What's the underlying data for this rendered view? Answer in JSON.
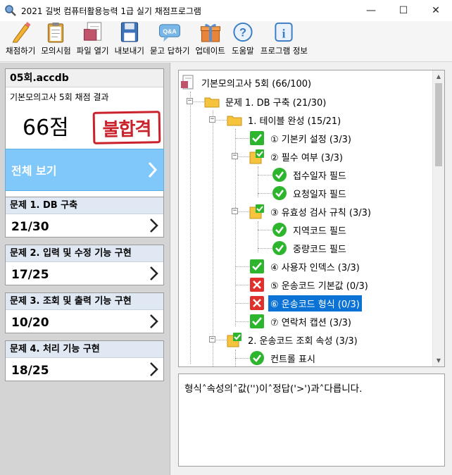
{
  "window": {
    "title": "2021 길벗 컴퓨터활용능력 1급 실기 채점프로그램",
    "controls": [
      "—",
      "☐",
      "✕"
    ]
  },
  "toolbar": [
    {
      "label": "채점하기",
      "icon": "pencil-icon"
    },
    {
      "label": "모의시험",
      "icon": "clipboard-icon"
    },
    {
      "label": "파일 열기",
      "icon": "open-file-icon"
    },
    {
      "label": "내보내기",
      "icon": "floppy-disk-icon"
    },
    {
      "label": "묻고 답하기",
      "icon": "qa-bubble-icon"
    },
    {
      "label": "업데이트",
      "icon": "gift-box-icon"
    },
    {
      "label": "도움말",
      "icon": "help-icon"
    },
    {
      "label": "프로그램 정보",
      "icon": "info-icon"
    }
  ],
  "result": {
    "file_name": "05회.accdb",
    "subtitle": "기본모의고사 5회 채점 결과",
    "score": "66점",
    "stamp": "불합격"
  },
  "nav": {
    "all_label": "전체 보기"
  },
  "problems": [
    {
      "title": "문제 1. DB 구축",
      "score": "21/30"
    },
    {
      "title": "문제 2. 입력 및 수정 기능 구현",
      "score": "17/25"
    },
    {
      "title": "문제 3. 조회 및 출력 기능 구현",
      "score": "10/20"
    },
    {
      "title": "문제 4. 처리 기능 구현",
      "score": "18/25"
    }
  ],
  "tree": {
    "root": "기본모의고사 5회 (66/100)",
    "nodes": [
      {
        "label": "문제 1. DB 구축 (21/30)",
        "icon": "folder-icon"
      },
      {
        "label": "1. 테이블 완성 (15/21)",
        "icon": "folder-icon"
      },
      {
        "label": "① 기본키 설정 (3/3)",
        "icon": "check-square-icon"
      },
      {
        "label": "② 필수 여부 (3/3)",
        "icon": "partial-check-icon"
      },
      {
        "label": "접수일자 필드",
        "icon": "check-circle-icon"
      },
      {
        "label": "요청일자 필드",
        "icon": "check-circle-icon"
      },
      {
        "label": "③ 유효성 검사 규칙 (3/3)",
        "icon": "partial-check-icon"
      },
      {
        "label": "지역코드 필드",
        "icon": "check-circle-icon"
      },
      {
        "label": "중량코드 필드",
        "icon": "check-circle-icon"
      },
      {
        "label": "④ 사용자 인덱스 (3/3)",
        "icon": "check-square-icon"
      },
      {
        "label": "⑤ 운송코드 기본값 (0/3)",
        "icon": "x-square-icon"
      },
      {
        "label": "⑥ 운송코드 형식 (0/3)",
        "icon": "x-square-icon"
      },
      {
        "label": "⑦ 연락처 캡션 (3/3)",
        "icon": "check-square-icon"
      },
      {
        "label": "2. 운송코드 조회 속성 (3/3)",
        "icon": "partial-check-icon"
      },
      {
        "label": "컨트롤 표시",
        "icon": "check-circle-icon"
      }
    ]
  },
  "message": "형식˄속성의˄값('')이˄정답('>')과˄다릅니다.",
  "colors": {
    "accent": "#0b73d6",
    "nav_all": "#80c8fa",
    "fail": "#c9222b",
    "ok": "#2db52d"
  }
}
